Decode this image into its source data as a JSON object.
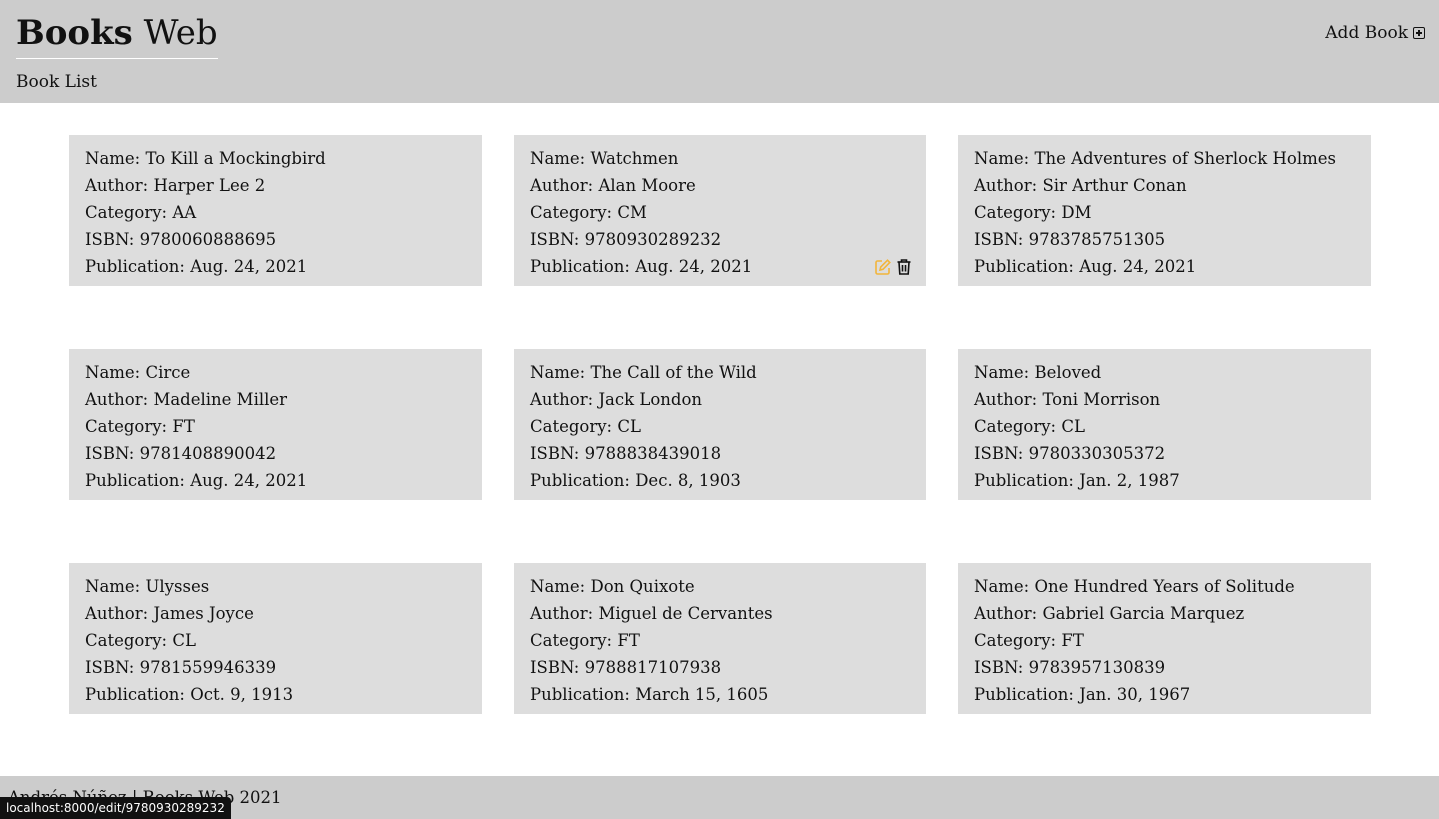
{
  "header": {
    "brand_bold": "Books",
    "brand_light": "Web",
    "nav_book_list": "Book List",
    "add_book_label": "Add Book"
  },
  "labels": {
    "name": "Name: ",
    "author": "Author: ",
    "category": "Category: ",
    "isbn": "ISBN: ",
    "publication": "Publication: "
  },
  "books": [
    {
      "name": "To Kill a Mockingbird",
      "author": "Harper Lee 2",
      "category": "AA",
      "isbn": "9780060888695",
      "publication": "Aug. 24, 2021"
    },
    {
      "name": "Watchmen",
      "author": "Alan Moore",
      "category": "CM",
      "isbn": "9780930289232",
      "publication": "Aug. 24, 2021"
    },
    {
      "name": "The Adventures of Sherlock Holmes",
      "author": "Sir Arthur Conan",
      "category": "DM",
      "isbn": "9783785751305",
      "publication": "Aug. 24, 2021"
    },
    {
      "name": "Circe",
      "author": "Madeline Miller",
      "category": "FT",
      "isbn": "9781408890042",
      "publication": "Aug. 24, 2021"
    },
    {
      "name": "The Call of the Wild",
      "author": "Jack London",
      "category": "CL",
      "isbn": "9788838439018",
      "publication": "Dec. 8, 1903"
    },
    {
      "name": "Beloved",
      "author": "Toni Morrison",
      "category": "CL",
      "isbn": "9780330305372",
      "publication": "Jan. 2, 1987"
    },
    {
      "name": "Ulysses",
      "author": "James Joyce",
      "category": "CL",
      "isbn": "9781559946339",
      "publication": "Oct. 9, 1913"
    },
    {
      "name": "Don Quixote",
      "author": "Miguel de Cervantes",
      "category": "FT",
      "isbn": "9788817107938",
      "publication": "March 15, 1605"
    },
    {
      "name": "One Hundred Years of Solitude",
      "author": "Gabriel Garcia Marquez",
      "category": "FT",
      "isbn": "9783957130839",
      "publication": "Jan. 30, 1967"
    }
  ],
  "hovered_card_index": 1,
  "icons": {
    "edit": "edit-icon",
    "delete": "trash-icon",
    "add": "plus-square-icon"
  },
  "colors": {
    "header_bg": "#cccccc",
    "card_bg": "#dddddd",
    "edit_icon": "#f2b53b"
  },
  "footer": {
    "text": "Andrés Núñez | Books Web 2021"
  },
  "status_bar": {
    "url": "localhost:8000/edit/9780930289232"
  }
}
